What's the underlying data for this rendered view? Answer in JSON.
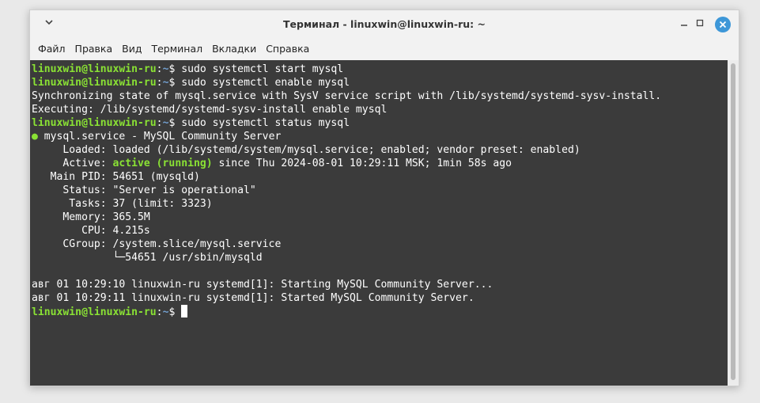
{
  "window": {
    "title": "Терминал - linuxwin@linuxwin-ru: ~",
    "menu_icon": "chevron-down-icon",
    "minimize_icon": "minimize-icon",
    "maximize_icon": "maximize-icon",
    "close_icon": "close-icon"
  },
  "menubar": {
    "items": [
      "Файл",
      "Правка",
      "Вид",
      "Терминал",
      "Вкладки",
      "Справка"
    ]
  },
  "colors": {
    "prompt": "#8ae234",
    "path": "#729fcf",
    "background": "#3b3b3b",
    "close_button": "#3d97d8"
  },
  "terminal": {
    "prompt_user": "linuxwin@linuxwin-ru",
    "prompt_path": "~",
    "lines": {
      "l0_cmd": "sudo systemctl start mysql",
      "l1_cmd": "sudo systemctl enable mysql",
      "l2": "Synchronizing state of mysql.service with SysV service script with /lib/systemd/systemd-sysv-install.",
      "l3": "Executing: /lib/systemd/systemd-sysv-install enable mysql",
      "l4_cmd": "sudo systemctl status mysql",
      "l5_dot": "●",
      "l5": " mysql.service - MySQL Community Server",
      "l6": "     Loaded: loaded (/lib/systemd/system/mysql.service; enabled; vendor preset: enabled)",
      "l7_pre": "     Active: ",
      "l7_status": "active (running)",
      "l7_post": " since Thu 2024-08-01 10:29:11 MSK; 1min 58s ago",
      "l8": "   Main PID: 54651 (mysqld)",
      "l9": "     Status: \"Server is operational\"",
      "l10": "      Tasks: 37 (limit: 3323)",
      "l11": "     Memory: 365.5M",
      "l12": "        CPU: 4.215s",
      "l13": "     CGroup: /system.slice/mysql.service",
      "l14": "             └─54651 /usr/sbin/mysqld",
      "l15": "",
      "l16": "авг 01 10:29:10 linuxwin-ru systemd[1]: Starting MySQL Community Server...",
      "l17": "авг 01 10:29:11 linuxwin-ru systemd[1]: Started MySQL Community Server."
    }
  }
}
